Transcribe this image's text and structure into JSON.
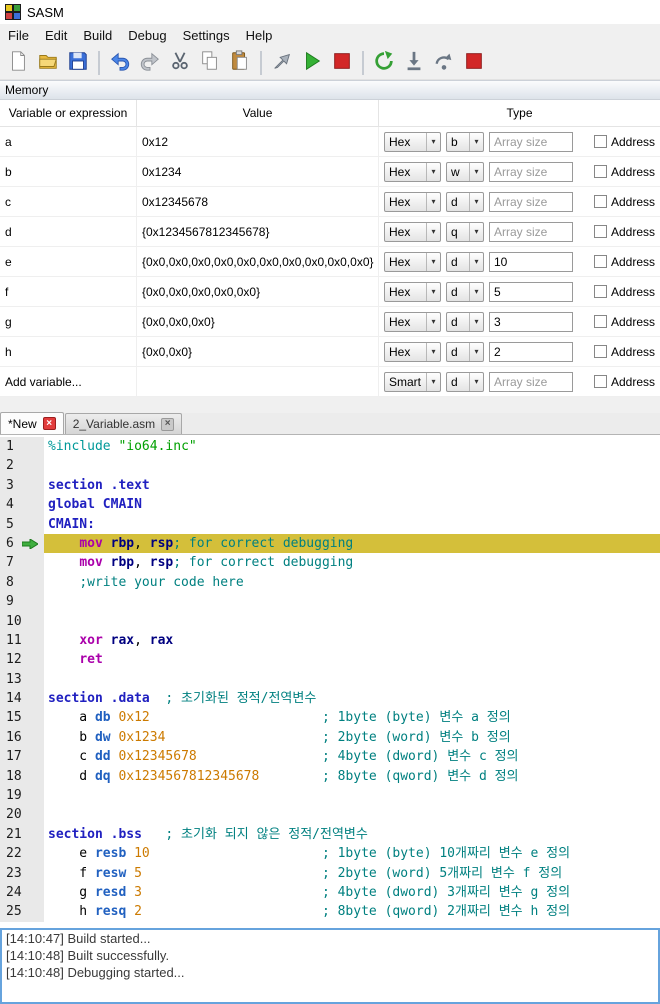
{
  "window": {
    "title": "SASM"
  },
  "menu": {
    "items": [
      "File",
      "Edit",
      "Build",
      "Debug",
      "Settings",
      "Help"
    ]
  },
  "toolbar": {
    "icons": [
      "new-file",
      "open-folder",
      "save",
      "separator",
      "undo",
      "redo",
      "cut",
      "copy",
      "paste",
      "separator",
      "build",
      "run",
      "stop",
      "separator",
      "debug",
      "step-into",
      "step-over",
      "debug-stop"
    ]
  },
  "memory": {
    "panel_title": "Memory",
    "columns": [
      "Variable or expression",
      "Value",
      "Type"
    ],
    "address_label": "Address",
    "array_placeholder": "Array size",
    "rows": [
      {
        "name": "a",
        "value": "0x12",
        "format": "Hex",
        "size": "b",
        "array": ""
      },
      {
        "name": "b",
        "value": "0x1234",
        "format": "Hex",
        "size": "w",
        "array": ""
      },
      {
        "name": "c",
        "value": "0x12345678",
        "format": "Hex",
        "size": "d",
        "array": ""
      },
      {
        "name": "d",
        "value": "{0x1234567812345678}",
        "format": "Hex",
        "size": "q",
        "array": ""
      },
      {
        "name": "e",
        "value": "{0x0,0x0,0x0,0x0,0x0,0x0,0x0,0x0,0x0,0x0}",
        "format": "Hex",
        "size": "d",
        "array": "10"
      },
      {
        "name": "f",
        "value": "{0x0,0x0,0x0,0x0,0x0}",
        "format": "Hex",
        "size": "d",
        "array": "5"
      },
      {
        "name": "g",
        "value": "{0x0,0x0,0x0}",
        "format": "Hex",
        "size": "d",
        "array": "3"
      },
      {
        "name": "h",
        "value": "{0x0,0x0}",
        "format": "Hex",
        "size": "d",
        "array": "2"
      },
      {
        "name": "Add variable...",
        "value": "",
        "format": "Smart",
        "size": "d",
        "array": "",
        "is_add_row": true
      }
    ]
  },
  "tabs": [
    {
      "label": "*New",
      "active": true
    },
    {
      "label": "2_Variable.asm",
      "active": false
    }
  ],
  "editor": {
    "current_line": 6,
    "lines": [
      {
        "n": 1,
        "s": [
          [
            "%include",
            "pp"
          ],
          [
            " ",
            ""
          ],
          [
            "\"io64.inc\"",
            "str"
          ]
        ]
      },
      {
        "n": 2,
        "s": []
      },
      {
        "n": 3,
        "s": [
          [
            "section .text",
            "kw"
          ]
        ]
      },
      {
        "n": 4,
        "s": [
          [
            "global CMAIN",
            "kw"
          ]
        ]
      },
      {
        "n": 5,
        "s": [
          [
            "CMAIN:",
            "kw"
          ]
        ]
      },
      {
        "n": 6,
        "s": [
          [
            "    ",
            ""
          ],
          [
            "mov",
            "ins"
          ],
          [
            " ",
            ""
          ],
          [
            "rbp",
            "reg"
          ],
          [
            ", ",
            ""
          ],
          [
            "rsp",
            "reg"
          ],
          [
            "; for correct debugging",
            "com"
          ]
        ]
      },
      {
        "n": 7,
        "s": [
          [
            "    ",
            ""
          ],
          [
            "mov",
            "ins"
          ],
          [
            " ",
            ""
          ],
          [
            "rbp",
            "reg"
          ],
          [
            ", ",
            ""
          ],
          [
            "rsp",
            "reg"
          ],
          [
            "; for correct debugging",
            "com"
          ]
        ]
      },
      {
        "n": 8,
        "s": [
          [
            "    ",
            ""
          ],
          [
            ";write your code here",
            "com"
          ]
        ]
      },
      {
        "n": 9,
        "s": []
      },
      {
        "n": 10,
        "s": []
      },
      {
        "n": 11,
        "s": [
          [
            "    ",
            ""
          ],
          [
            "xor",
            "ins"
          ],
          [
            " ",
            ""
          ],
          [
            "rax",
            "reg"
          ],
          [
            ", ",
            ""
          ],
          [
            "rax",
            "reg"
          ]
        ]
      },
      {
        "n": 12,
        "s": [
          [
            "    ",
            ""
          ],
          [
            "ret",
            "ins"
          ]
        ]
      },
      {
        "n": 13,
        "s": []
      },
      {
        "n": 14,
        "s": [
          [
            "section .data",
            "kw"
          ],
          [
            "  ",
            ""
          ],
          [
            "; 초기화된 정적/전역변수",
            "com"
          ]
        ]
      },
      {
        "n": 15,
        "s": [
          [
            "    a ",
            ""
          ],
          [
            "db",
            "def"
          ],
          [
            " ",
            ""
          ],
          [
            "0x12",
            "num"
          ],
          [
            "                      ",
            ""
          ],
          [
            "; 1byte (byte) 변수 a 정의",
            "com"
          ]
        ]
      },
      {
        "n": 16,
        "s": [
          [
            "    b ",
            ""
          ],
          [
            "dw",
            "def"
          ],
          [
            " ",
            ""
          ],
          [
            "0x1234",
            "num"
          ],
          [
            "                    ",
            ""
          ],
          [
            "; 2byte (word) 변수 b 정의",
            "com"
          ]
        ]
      },
      {
        "n": 17,
        "s": [
          [
            "    c ",
            ""
          ],
          [
            "dd",
            "def"
          ],
          [
            " ",
            ""
          ],
          [
            "0x12345678",
            "num"
          ],
          [
            "                ",
            ""
          ],
          [
            "; 4byte (dword) 변수 c 정의",
            "com"
          ]
        ]
      },
      {
        "n": 18,
        "s": [
          [
            "    d ",
            ""
          ],
          [
            "dq",
            "def"
          ],
          [
            " ",
            ""
          ],
          [
            "0x1234567812345678",
            "num"
          ],
          [
            "        ",
            ""
          ],
          [
            "; 8byte (qword) 변수 d 정의",
            "com"
          ]
        ]
      },
      {
        "n": 19,
        "s": []
      },
      {
        "n": 20,
        "s": []
      },
      {
        "n": 21,
        "s": [
          [
            "section .bss",
            "kw"
          ],
          [
            "   ",
            ""
          ],
          [
            "; 초기화 되지 않은 정적/전역변수",
            "com"
          ]
        ]
      },
      {
        "n": 22,
        "s": [
          [
            "    e ",
            ""
          ],
          [
            "resb",
            "def"
          ],
          [
            " ",
            ""
          ],
          [
            "10",
            "num"
          ],
          [
            "                      ",
            ""
          ],
          [
            "; 1byte (byte) 10개짜리 변수 e 정의",
            "com"
          ]
        ]
      },
      {
        "n": 23,
        "s": [
          [
            "    f ",
            ""
          ],
          [
            "resw",
            "def"
          ],
          [
            " ",
            ""
          ],
          [
            "5",
            "num"
          ],
          [
            "                       ",
            ""
          ],
          [
            "; 2byte (word) 5개짜리 변수 f 정의",
            "com"
          ]
        ]
      },
      {
        "n": 24,
        "s": [
          [
            "    g ",
            ""
          ],
          [
            "resd",
            "def"
          ],
          [
            " ",
            ""
          ],
          [
            "3",
            "num"
          ],
          [
            "                       ",
            ""
          ],
          [
            "; 4byte (dword) 3개짜리 변수 g 정의",
            "com"
          ]
        ]
      },
      {
        "n": 25,
        "s": [
          [
            "    h ",
            ""
          ],
          [
            "resq",
            "def"
          ],
          [
            " ",
            ""
          ],
          [
            "2",
            "num"
          ],
          [
            "                       ",
            ""
          ],
          [
            "; 8byte (qword) 2개짜리 변수 h 정의",
            "com"
          ]
        ]
      }
    ]
  },
  "log": {
    "lines": [
      "[14:10:47] Build started...",
      "[14:10:48] Built successfully.",
      "[14:10:48] Debugging started..."
    ]
  },
  "colors": {
    "current_line_highlight": "#d4bf3a",
    "debug_arrow": "#3fae3f",
    "log_border": "#66a3dd"
  }
}
